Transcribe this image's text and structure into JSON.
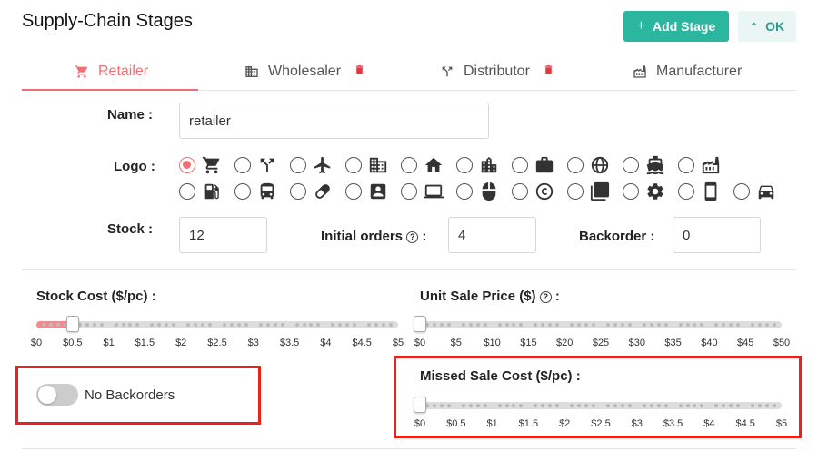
{
  "header": {
    "title": "Supply-Chain Stages",
    "add_stage_label": "Add Stage",
    "ok_label": "OK"
  },
  "tabs": [
    {
      "label": "Retailer",
      "icon": "cart-icon",
      "active": true,
      "deletable": false
    },
    {
      "label": "Wholesaler",
      "icon": "building-icon",
      "active": false,
      "deletable": true
    },
    {
      "label": "Distributor",
      "icon": "fork-icon",
      "active": false,
      "deletable": true
    },
    {
      "label": "Manufacturer",
      "icon": "factory-icon",
      "active": false,
      "deletable": false
    }
  ],
  "form": {
    "name_label": "Name :",
    "name_value": "retailer",
    "logo_label": "Logo :",
    "logo_selected": "cart",
    "logo_options_row1": [
      "cart",
      "fork",
      "airplane",
      "office-building",
      "home",
      "city",
      "briefcase",
      "globe",
      "ship",
      "factory"
    ],
    "logo_options_row2": [
      "gas-station",
      "bus",
      "pill",
      "contact-card",
      "laptop",
      "mouse",
      "copyright",
      "copy",
      "gear",
      "phone",
      "car"
    ],
    "stock_label": "Stock :",
    "stock_value": "12",
    "initial_orders_label": "Initial orders",
    "initial_orders_suffix": ":",
    "initial_orders_value": "4",
    "backorder_label": "Backorder :",
    "backorder_value": "0"
  },
  "sliders": {
    "stock_cost": {
      "label": "Stock Cost ($/pc) :",
      "value": 0.5,
      "min": 0,
      "max": 5,
      "ticks": [
        "$0",
        "$0.5",
        "$1",
        "$1.5",
        "$2",
        "$2.5",
        "$3",
        "$3.5",
        "$4",
        "$4.5",
        "$5"
      ]
    },
    "unit_sale_price": {
      "label": "Unit Sale Price ($)",
      "label_suffix": ":",
      "value": 0,
      "min": 0,
      "max": 50,
      "ticks": [
        "$0",
        "$5",
        "$10",
        "$15",
        "$20",
        "$25",
        "$30",
        "$35",
        "$40",
        "$45",
        "$50"
      ]
    },
    "missed_sale_cost": {
      "label": "Missed Sale Cost ($/pc) :",
      "value": 0,
      "min": 0,
      "max": 5,
      "ticks": [
        "$0",
        "$0.5",
        "$1",
        "$1.5",
        "$2",
        "$2.5",
        "$3",
        "$3.5",
        "$4",
        "$4.5",
        "$5"
      ]
    }
  },
  "toggle": {
    "label": "No Backorders",
    "enabled": false
  },
  "colors": {
    "accent": "#ef6f74",
    "primary_button": "#2bb6a0",
    "highlight_box": "#e8231c",
    "trash": "#e0393e"
  }
}
